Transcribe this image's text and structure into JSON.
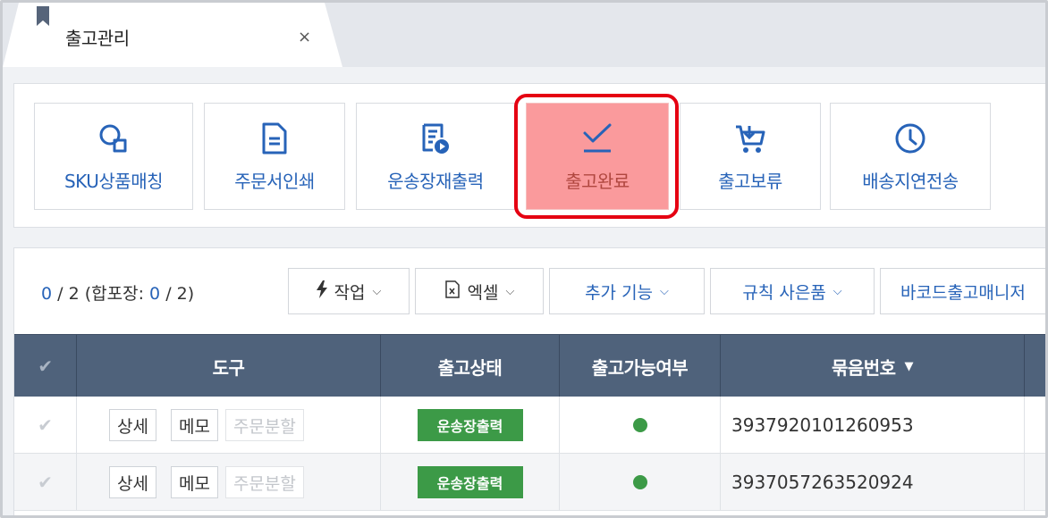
{
  "tab": {
    "title": "출고관리",
    "close": "×"
  },
  "toolbar": {
    "items": [
      {
        "label": "SKU상품매칭",
        "icon": "sku-match-icon"
      },
      {
        "label": "주문서인쇄",
        "icon": "document-icon"
      },
      {
        "label": "운송장재출력",
        "icon": "waybill-reprint-icon"
      },
      {
        "label": "출고완료",
        "icon": "check-complete-icon"
      },
      {
        "label": "출고보류",
        "icon": "cart-hold-icon"
      },
      {
        "label": "배송지연전송",
        "icon": "clock-icon"
      }
    ],
    "highlight_color": "#e50012"
  },
  "counter": {
    "selected": "0",
    "slash1": "/",
    "total": "2",
    "combined_label": "(합포장:",
    "combined_selected": "0",
    "slash2": "/",
    "combined_total": "2)"
  },
  "actions": {
    "work": "작업",
    "excel": "엑셀",
    "extra": "추가 기능",
    "gift_rule": "규칙 사은품",
    "barcode": "바코드출고매니저"
  },
  "table": {
    "headers": {
      "tools": "도구",
      "status": "출고상태",
      "available": "출고가능여부",
      "bundle_no": "묶음번호"
    },
    "row_buttons": {
      "detail": "상세",
      "memo": "메모",
      "split": "주문분할"
    },
    "rows": [
      {
        "status": "운송장출력",
        "available": true,
        "bundle_no": "3937920101260953"
      },
      {
        "status": "운송장출력",
        "available": true,
        "bundle_no": "3937057263520924"
      }
    ]
  },
  "colors": {
    "header_bg": "#4f627b",
    "accent_blue": "#2763b8",
    "status_green": "#3c9a47"
  }
}
